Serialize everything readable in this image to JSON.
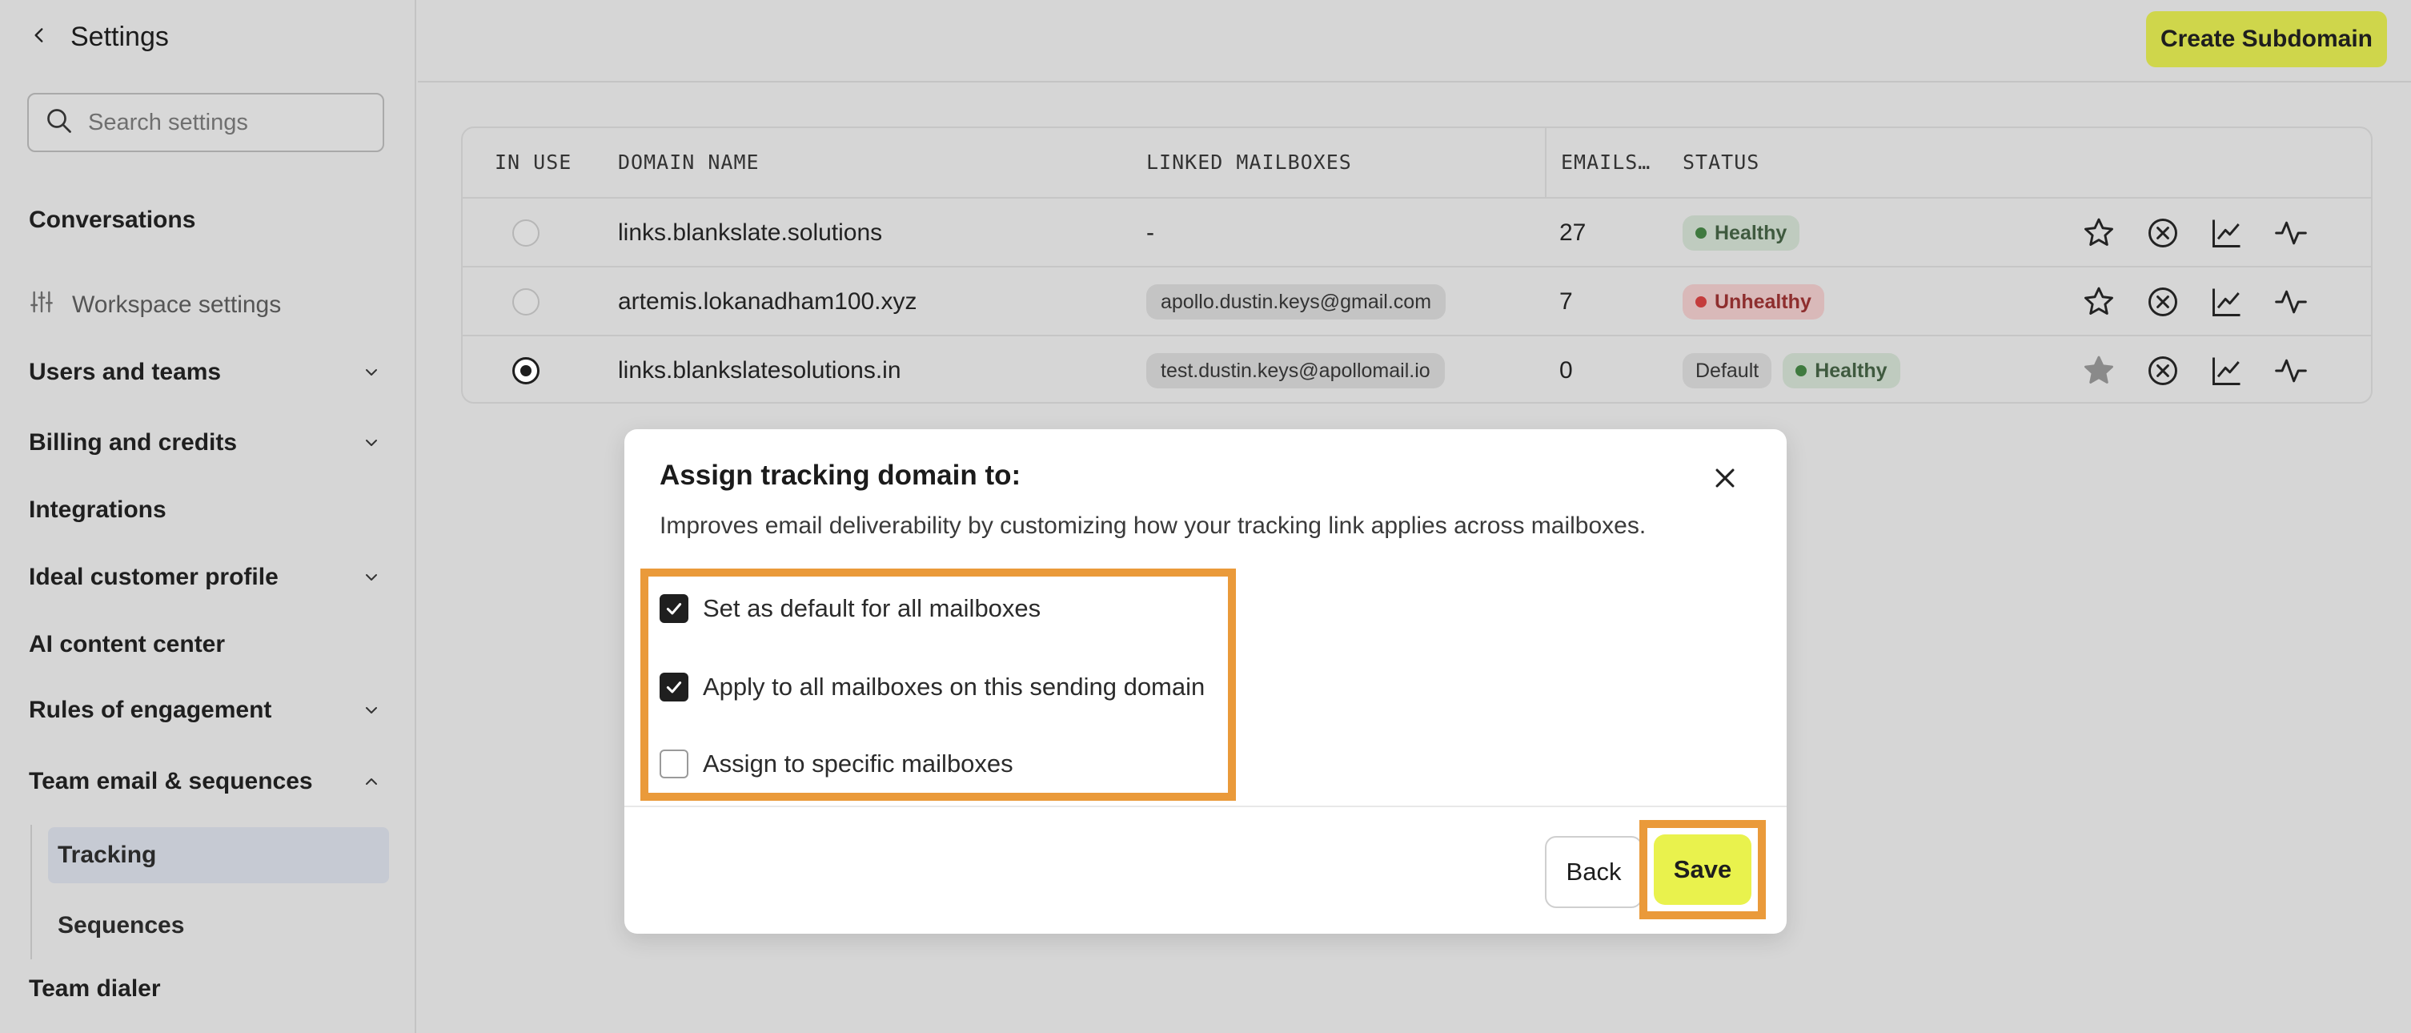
{
  "sidebar": {
    "title": "Settings",
    "search_placeholder": "Search settings",
    "items": [
      {
        "label": "Conversations"
      },
      {
        "label": "Workspace settings"
      },
      {
        "label": "Users and teams"
      },
      {
        "label": "Billing and credits"
      },
      {
        "label": "Integrations"
      },
      {
        "label": "Ideal customer profile"
      },
      {
        "label": "AI content center"
      },
      {
        "label": "Rules of engagement"
      },
      {
        "label": "Team email & sequences"
      },
      {
        "label": "Tracking"
      },
      {
        "label": "Sequences"
      },
      {
        "label": "Team dialer"
      }
    ]
  },
  "topbar": {
    "create_label": "Create Subdomain"
  },
  "table": {
    "headers": [
      "IN USE",
      "DOMAIN NAME",
      "LINKED MAILBOXES",
      "EMAILS…",
      "STATUS"
    ],
    "rows": [
      {
        "domain": "links.blankslate.solutions",
        "mailbox": "-",
        "emails": "27",
        "status": "Healthy",
        "default": "",
        "in_use": false
      },
      {
        "domain": "artemis.lokanadham100.xyz",
        "mailbox": "apollo.dustin.keys@gmail.com",
        "emails": "7",
        "status": "Unhealthy",
        "default": "",
        "in_use": false
      },
      {
        "domain": "links.blankslatesolutions.in",
        "mailbox": "test.dustin.keys@apollomail.io",
        "emails": "0",
        "status": "Healthy",
        "default": "Default",
        "in_use": true
      }
    ]
  },
  "modal": {
    "title": "Assign tracking domain to:",
    "description": "Improves email deliverability by customizing how your tracking link applies across mailboxes.",
    "options": [
      {
        "label": "Set as default for all mailboxes",
        "checked": true
      },
      {
        "label": "Apply to all mailboxes on this sending domain",
        "checked": true
      },
      {
        "label": "Assign to specific mailboxes",
        "checked": false
      }
    ],
    "back_label": "Back",
    "save_label": "Save"
  },
  "colors": {
    "accent": "#e9f24d",
    "highlight": "#ea9a3a",
    "healthy": "#3f7a3f",
    "unhealthy": "#c43c3c"
  }
}
